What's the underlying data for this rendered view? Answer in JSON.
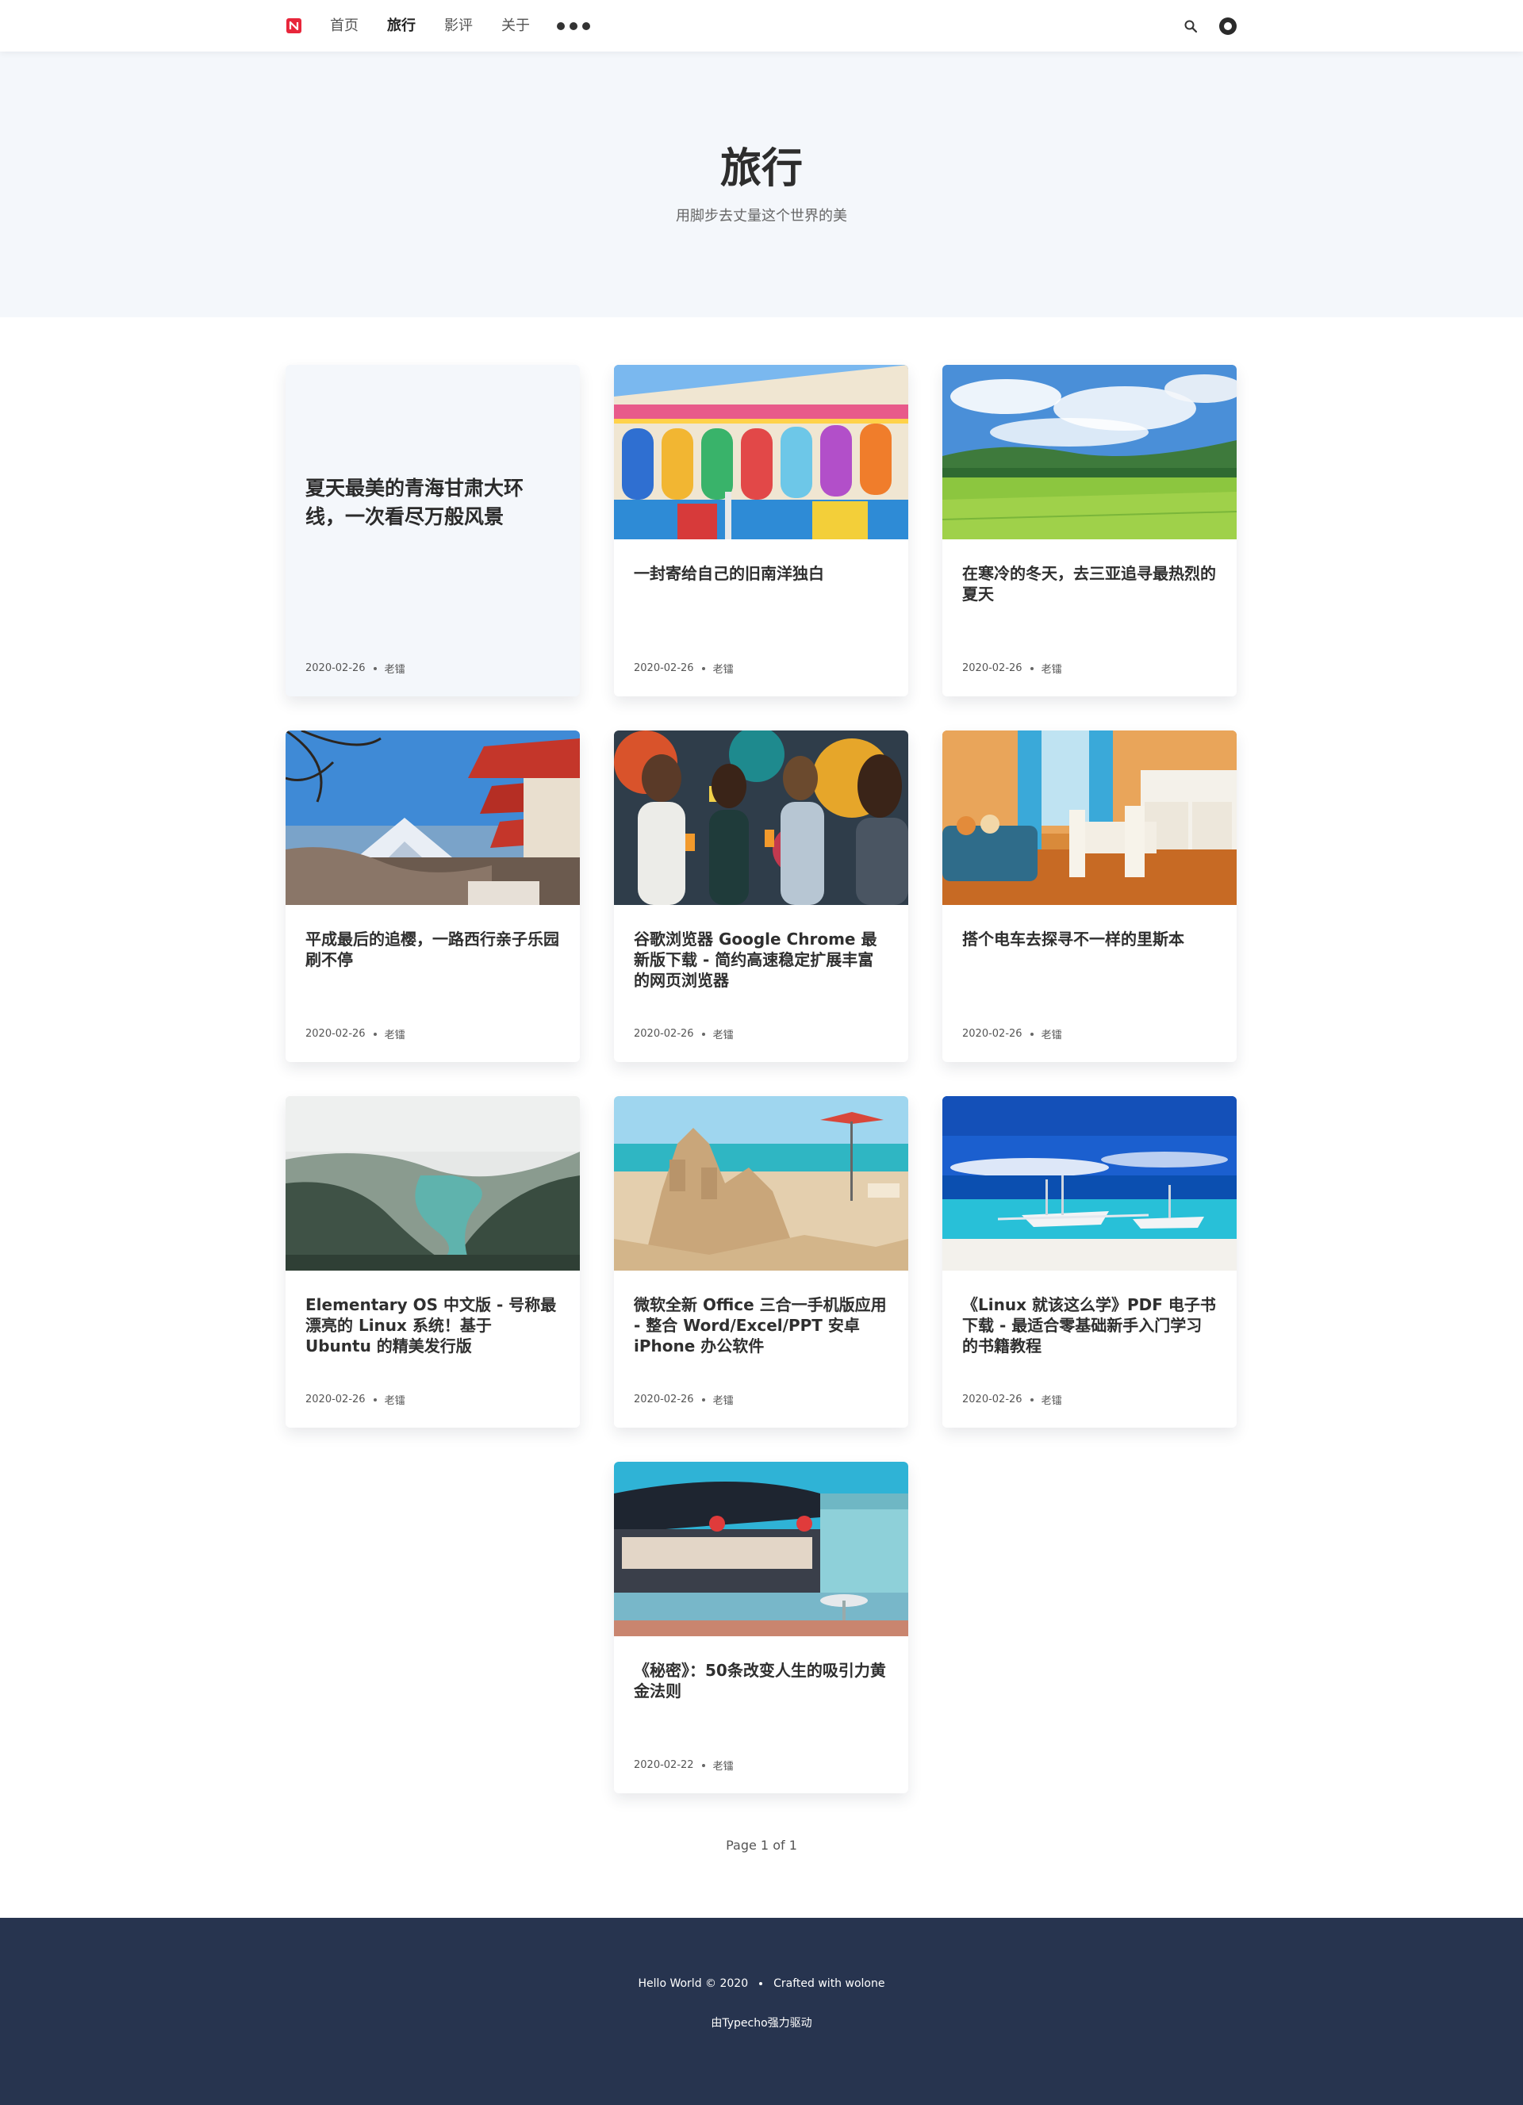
{
  "header": {
    "logo_icon": "notebook-logo-icon",
    "brand_color": "#e8263b",
    "nav": [
      {
        "label": "首页",
        "active": false
      },
      {
        "label": "旅行",
        "active": true
      },
      {
        "label": "影评",
        "active": false
      },
      {
        "label": "关于",
        "active": false
      }
    ],
    "more_icon": "more-dots-icon",
    "search_icon": "search-icon",
    "theme_icon": "theme-toggle-icon"
  },
  "hero": {
    "title": "旅行",
    "subtitle": "用脚步去丈量这个世界的美"
  },
  "posts": [
    {
      "title": "夏天最美的青海甘肃大环线，一次看尽万般风景",
      "date": "2020-02-26",
      "author": "老镭",
      "image": "none"
    },
    {
      "title": "一封寄给自己的旧南洋独白",
      "date": "2020-02-26",
      "author": "老镭",
      "image": "colorful-colonial-building-photo"
    },
    {
      "title": "在寒冷的冬天，去三亚追寻最热烈的夏天",
      "date": "2020-02-26",
      "author": "老镭",
      "image": "green-field-landscape-photo"
    },
    {
      "title": "平成最后的追樱，一路西行亲子乐园刷不停",
      "date": "2020-02-26",
      "author": "老镭",
      "image": "mount-fuji-pagoda-photo"
    },
    {
      "title": "谷歌浏览器 Google Chrome 最新版下载 - 简约高速稳定扩展丰富的网页浏览器",
      "date": "2020-02-26",
      "author": "老镭",
      "image": "friends-with-drinks-photo"
    },
    {
      "title": "搭个电车去探寻不一样的里斯本",
      "date": "2020-02-26",
      "author": "老镭",
      "image": "apartment-interior-photo"
    },
    {
      "title": "Elementary OS 中文版 - 号称最漂亮的 Linux 系统！基于 Ubuntu 的精美发行版",
      "date": "2020-02-26",
      "author": "老镭",
      "image": "misty-river-forest-photo"
    },
    {
      "title": "微软全新 Office 三合一手机版应用 - 整合 Word/Excel/PPT 安卓 iPhone 办公软件",
      "date": "2020-02-26",
      "author": "老镭",
      "image": "sand-castle-beach-photo"
    },
    {
      "title": "《Linux 就该这么学》PDF 电子书下载 - 最适合零基础新手入门学习的书籍教程",
      "date": "2020-02-26",
      "author": "老镭",
      "image": "tropical-boats-beach-photo"
    },
    {
      "title": "《秘密》：50条改变人生的吸引力黄金法则",
      "date": "2020-02-22",
      "author": "老镭",
      "image": "retro-diner-photo"
    }
  ],
  "pagination": {
    "text": "Page 1 of 1"
  },
  "footer": {
    "copyright": "Hello World © 2020",
    "crafted": "Crafted with wolone",
    "powered": "由Typecho强力驱动"
  },
  "colors": {
    "hero_bg": "#f4f7fb",
    "footer_bg": "#27344f",
    "text_dark": "#2f2f2f"
  }
}
